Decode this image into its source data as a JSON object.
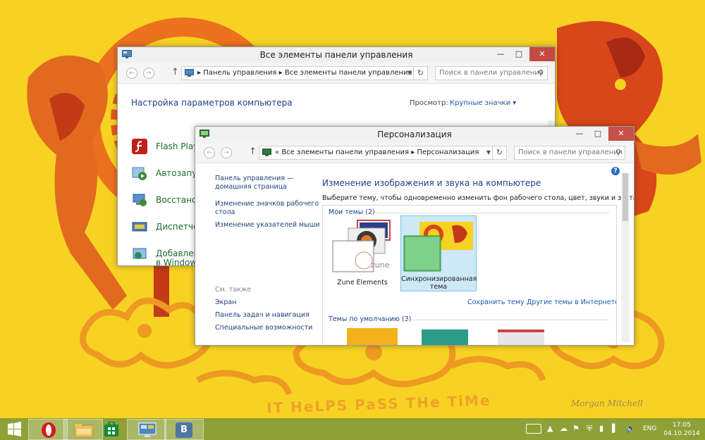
{
  "wallpaper": {
    "caption": "IT HeLPS PaSS THe TiMe",
    "signature": "Morgan Mitchell"
  },
  "back_window": {
    "title": "Все элементы панели управления",
    "address": {
      "crumb1": "Панель управления",
      "sep": "▸",
      "crumb2": "Все элементы панели управления"
    },
    "search_placeholder": "Поиск в панели управления",
    "heading": "Настройка параметров компьютера",
    "view_label": "Просмотр:",
    "view_value": "Крупные значки ▾",
    "items": [
      {
        "label": "Flash Player",
        "icon": "flash-icon",
        "color": "#c0201a"
      },
      {
        "label": "Автозапуск",
        "icon": "autoplay-icon",
        "color": "#3c8a3a"
      },
      {
        "label": "Восстановление",
        "icon": "recovery-icon",
        "color": "#3a6bb8"
      },
      {
        "label": "Диспетчер",
        "icon": "device-manager-icon",
        "color": "#4a7db8"
      },
      {
        "label": "Добавление",
        "icon": "add-features-icon",
        "color": "#2f8a5a"
      }
    ],
    "item_extra": "в Windows"
  },
  "front_window": {
    "title": "Персонализация",
    "address": {
      "back": "«",
      "crumb1": "Все элементы панели управления",
      "sep": "▸",
      "crumb2": "Персонализация"
    },
    "search_placeholder": "Поиск в панели управления",
    "left_links": {
      "home_line1": "Панель управления —",
      "home_line2": "домашняя страница",
      "icons_line1": "Изменение значков рабочего",
      "icons_line2": "стола",
      "pointers": "Изменение указателей мыши",
      "see_also": "См. также",
      "screen": "Экран",
      "taskbar": "Панель задач и навигация",
      "accessibility": "Специальные возможности"
    },
    "heading": "Изменение изображения и звука на компьютере",
    "description": "Выберите тему, чтобы одновременно изменить фон рабочего стола, цвет, звуки и заставку.",
    "my_themes": "Мои темы (2)",
    "themes": [
      {
        "name": "Zune Elements"
      },
      {
        "name_line1": "Синхронизированная",
        "name_line2": "тема"
      }
    ],
    "save_theme": "Сохранить тему",
    "more_themes": "Другие темы в Интернете",
    "default_themes": "Темы по умолчанию (3)",
    "zune_logo": "zune",
    "help": "?"
  },
  "taskbar": {
    "apps": [
      {
        "name": "opera",
        "icon": "opera-icon"
      },
      {
        "name": "file-explorer",
        "icon": "folder-icon"
      },
      {
        "name": "store",
        "icon": "store-icon"
      },
      {
        "name": "control-panel",
        "icon": "control-panel-icon"
      },
      {
        "name": "vk",
        "icon": "vk-icon",
        "text": "B"
      }
    ],
    "lang": "ENG",
    "time": "17:05",
    "date": "04.10.2014"
  }
}
